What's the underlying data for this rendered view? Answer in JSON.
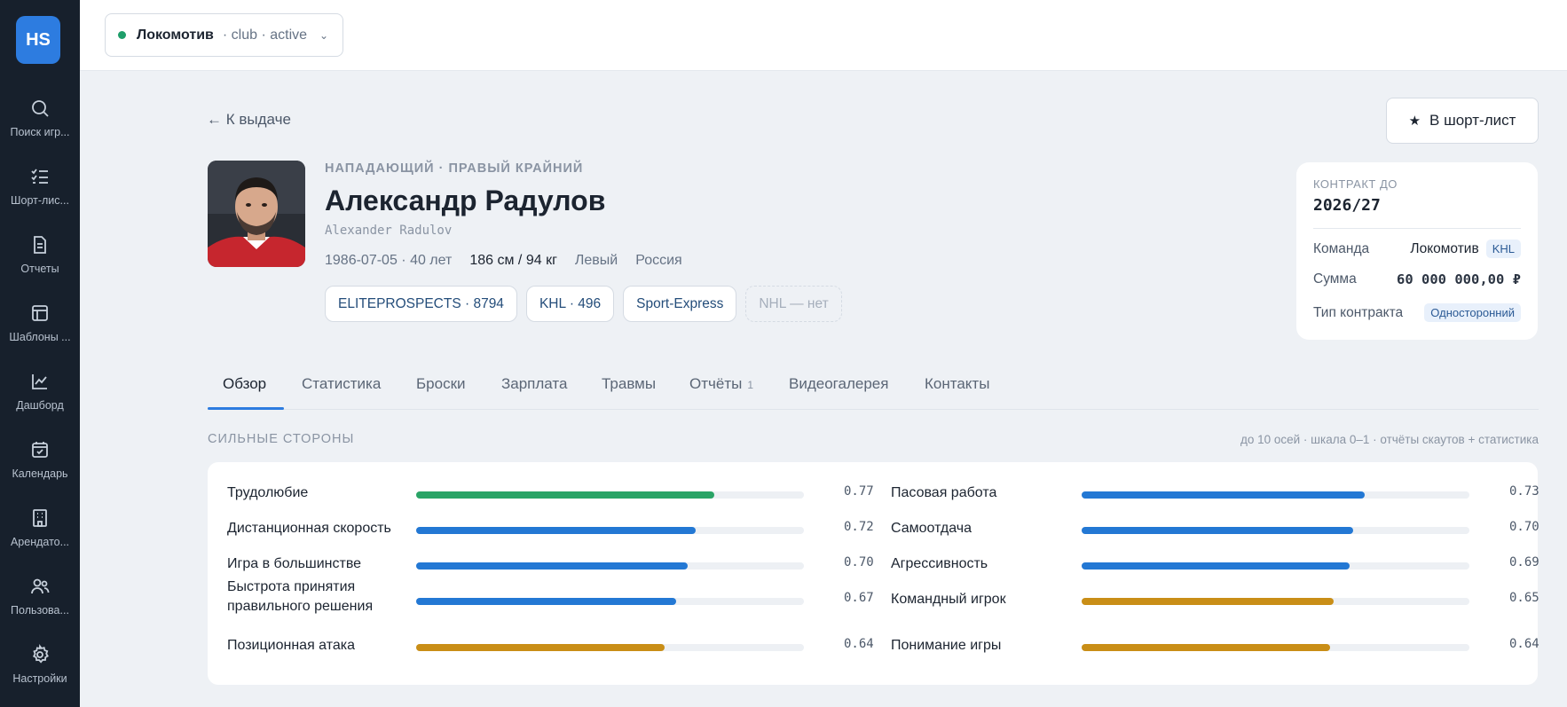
{
  "app": {
    "logo": "HS"
  },
  "sidebar": {
    "items": [
      {
        "label": "Поиск игр...",
        "icon": "search-icon"
      },
      {
        "label": "Шорт-лис...",
        "icon": "list-check-icon"
      },
      {
        "label": "Отчеты",
        "icon": "document-icon"
      },
      {
        "label": "Шаблоны ...",
        "icon": "layout-icon"
      },
      {
        "label": "Дашборд",
        "icon": "chart-line-icon"
      },
      {
        "label": "Календарь",
        "icon": "calendar-check-icon"
      },
      {
        "label": "Арендато...",
        "icon": "building-icon"
      },
      {
        "label": "Пользова...",
        "icon": "users-icon"
      },
      {
        "label": "Настройки",
        "icon": "gear-icon"
      }
    ]
  },
  "topbar": {
    "club": {
      "name": "Локомотив",
      "meta": "· club · active",
      "status_color": "#1e9e6a"
    }
  },
  "back_link": "← К выдаче",
  "shortlist_button": "В шорт-лист",
  "player": {
    "position": "НАПАДАЮЩИЙ · ПРАВЫЙ КРАЙНИЙ",
    "name": "Александр Радулов",
    "latin_name": "Alexander Radulov",
    "birth_age": "1986-07-05 · 40 лет",
    "height_weight": "186 см / 94 кг",
    "hand": "Левый",
    "country": "Россия",
    "tags": [
      {
        "label": "ELITEPROSPECTS · 8794",
        "muted": false
      },
      {
        "label": "KHL · 496",
        "muted": false
      },
      {
        "label": "Sport-Express",
        "muted": false
      },
      {
        "label": "NHL — нет",
        "muted": true
      }
    ]
  },
  "contract": {
    "title": "КОНТРАКТ ДО",
    "until": "2026/27",
    "team_label": "Команда",
    "team_value": "Локомотив",
    "team_badge": "KHL",
    "sum_label": "Сумма",
    "sum_value": "60 000 000,00 ₽",
    "type_label": "Тип контракта",
    "type_value": "Односторонний"
  },
  "tabs": [
    {
      "label": "Обзор",
      "active": true
    },
    {
      "label": "Статистика"
    },
    {
      "label": "Броски"
    },
    {
      "label": "Зарплата"
    },
    {
      "label": "Травмы"
    },
    {
      "label": "Отчёты",
      "count": "1"
    },
    {
      "label": "Видеогалерея"
    },
    {
      "label": "Контакты"
    }
  ],
  "strengths": {
    "title": "СИЛЬНЫЕ СТОРОНЫ",
    "note": "до 10 осей · шкала 0–1 · отчёты скаутов + статистика",
    "colors": {
      "green": "#2aa466",
      "blue": "#2378d4",
      "gold": "#c98e17"
    },
    "left": [
      {
        "label": "Трудолюбие",
        "value": 0.77,
        "display": "0.77",
        "color": "green"
      },
      {
        "label": "Дистанционная скорость",
        "value": 0.72,
        "display": "0.72",
        "color": "blue"
      },
      {
        "label": "Игра в большинстве",
        "value": 0.7,
        "display": "0.70",
        "color": "blue"
      },
      {
        "label": "Быстрота принятия правильного решения",
        "value": 0.67,
        "display": "0.67",
        "color": "blue"
      },
      {
        "label": "Позиционная атака",
        "value": 0.64,
        "display": "0.64",
        "color": "gold"
      }
    ],
    "right": [
      {
        "label": "Пасовая работа",
        "value": 0.73,
        "display": "0.73",
        "color": "blue"
      },
      {
        "label": "Самоотдача",
        "value": 0.7,
        "display": "0.70",
        "color": "blue"
      },
      {
        "label": "Агрессивность",
        "value": 0.69,
        "display": "0.69",
        "color": "blue"
      },
      {
        "label": "Командный игрок",
        "value": 0.65,
        "display": "0.65",
        "color": "gold"
      },
      {
        "label": "Понимание игры",
        "value": 0.64,
        "display": "0.64",
        "color": "gold"
      }
    ]
  }
}
